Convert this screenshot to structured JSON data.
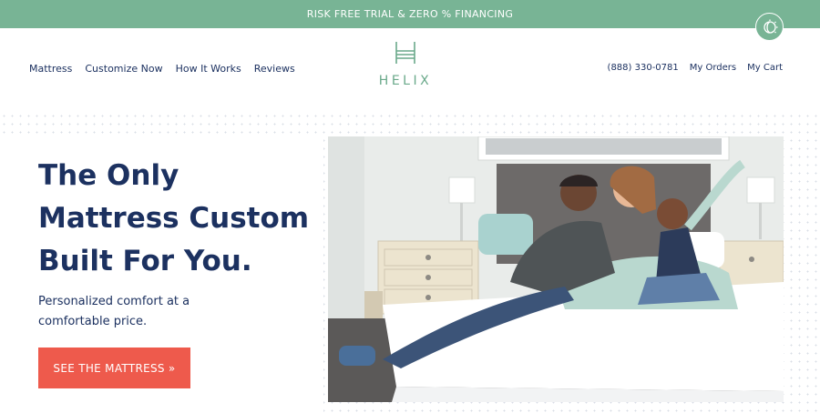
{
  "promo": {
    "text": "RISK FREE TRIAL & ZERO % FINANCING"
  },
  "chat": {
    "icon": "chat-icon"
  },
  "nav": {
    "left": [
      "Mattress",
      "Customize Now",
      "How It Works",
      "Reviews"
    ],
    "right": {
      "phone": "(888) 330-0781",
      "orders": "My Orders",
      "cart": "My Cart"
    }
  },
  "logo": {
    "wordmark": "HELIX",
    "icon": "helix-bed-logo-icon"
  },
  "hero": {
    "title_lines": [
      "The Only",
      "Mattress Custom",
      "Built For You."
    ],
    "subtitle_lines": [
      "Personalized comfort at a",
      "comfortable price."
    ],
    "cta_label": "SEE THE MATTRESS »",
    "image": "family-on-bed-photo"
  },
  "colors": {
    "banner": "#78b495",
    "navy": "#1c3160",
    "cta": "#ee5a4c",
    "logo": "#6aa98a"
  }
}
